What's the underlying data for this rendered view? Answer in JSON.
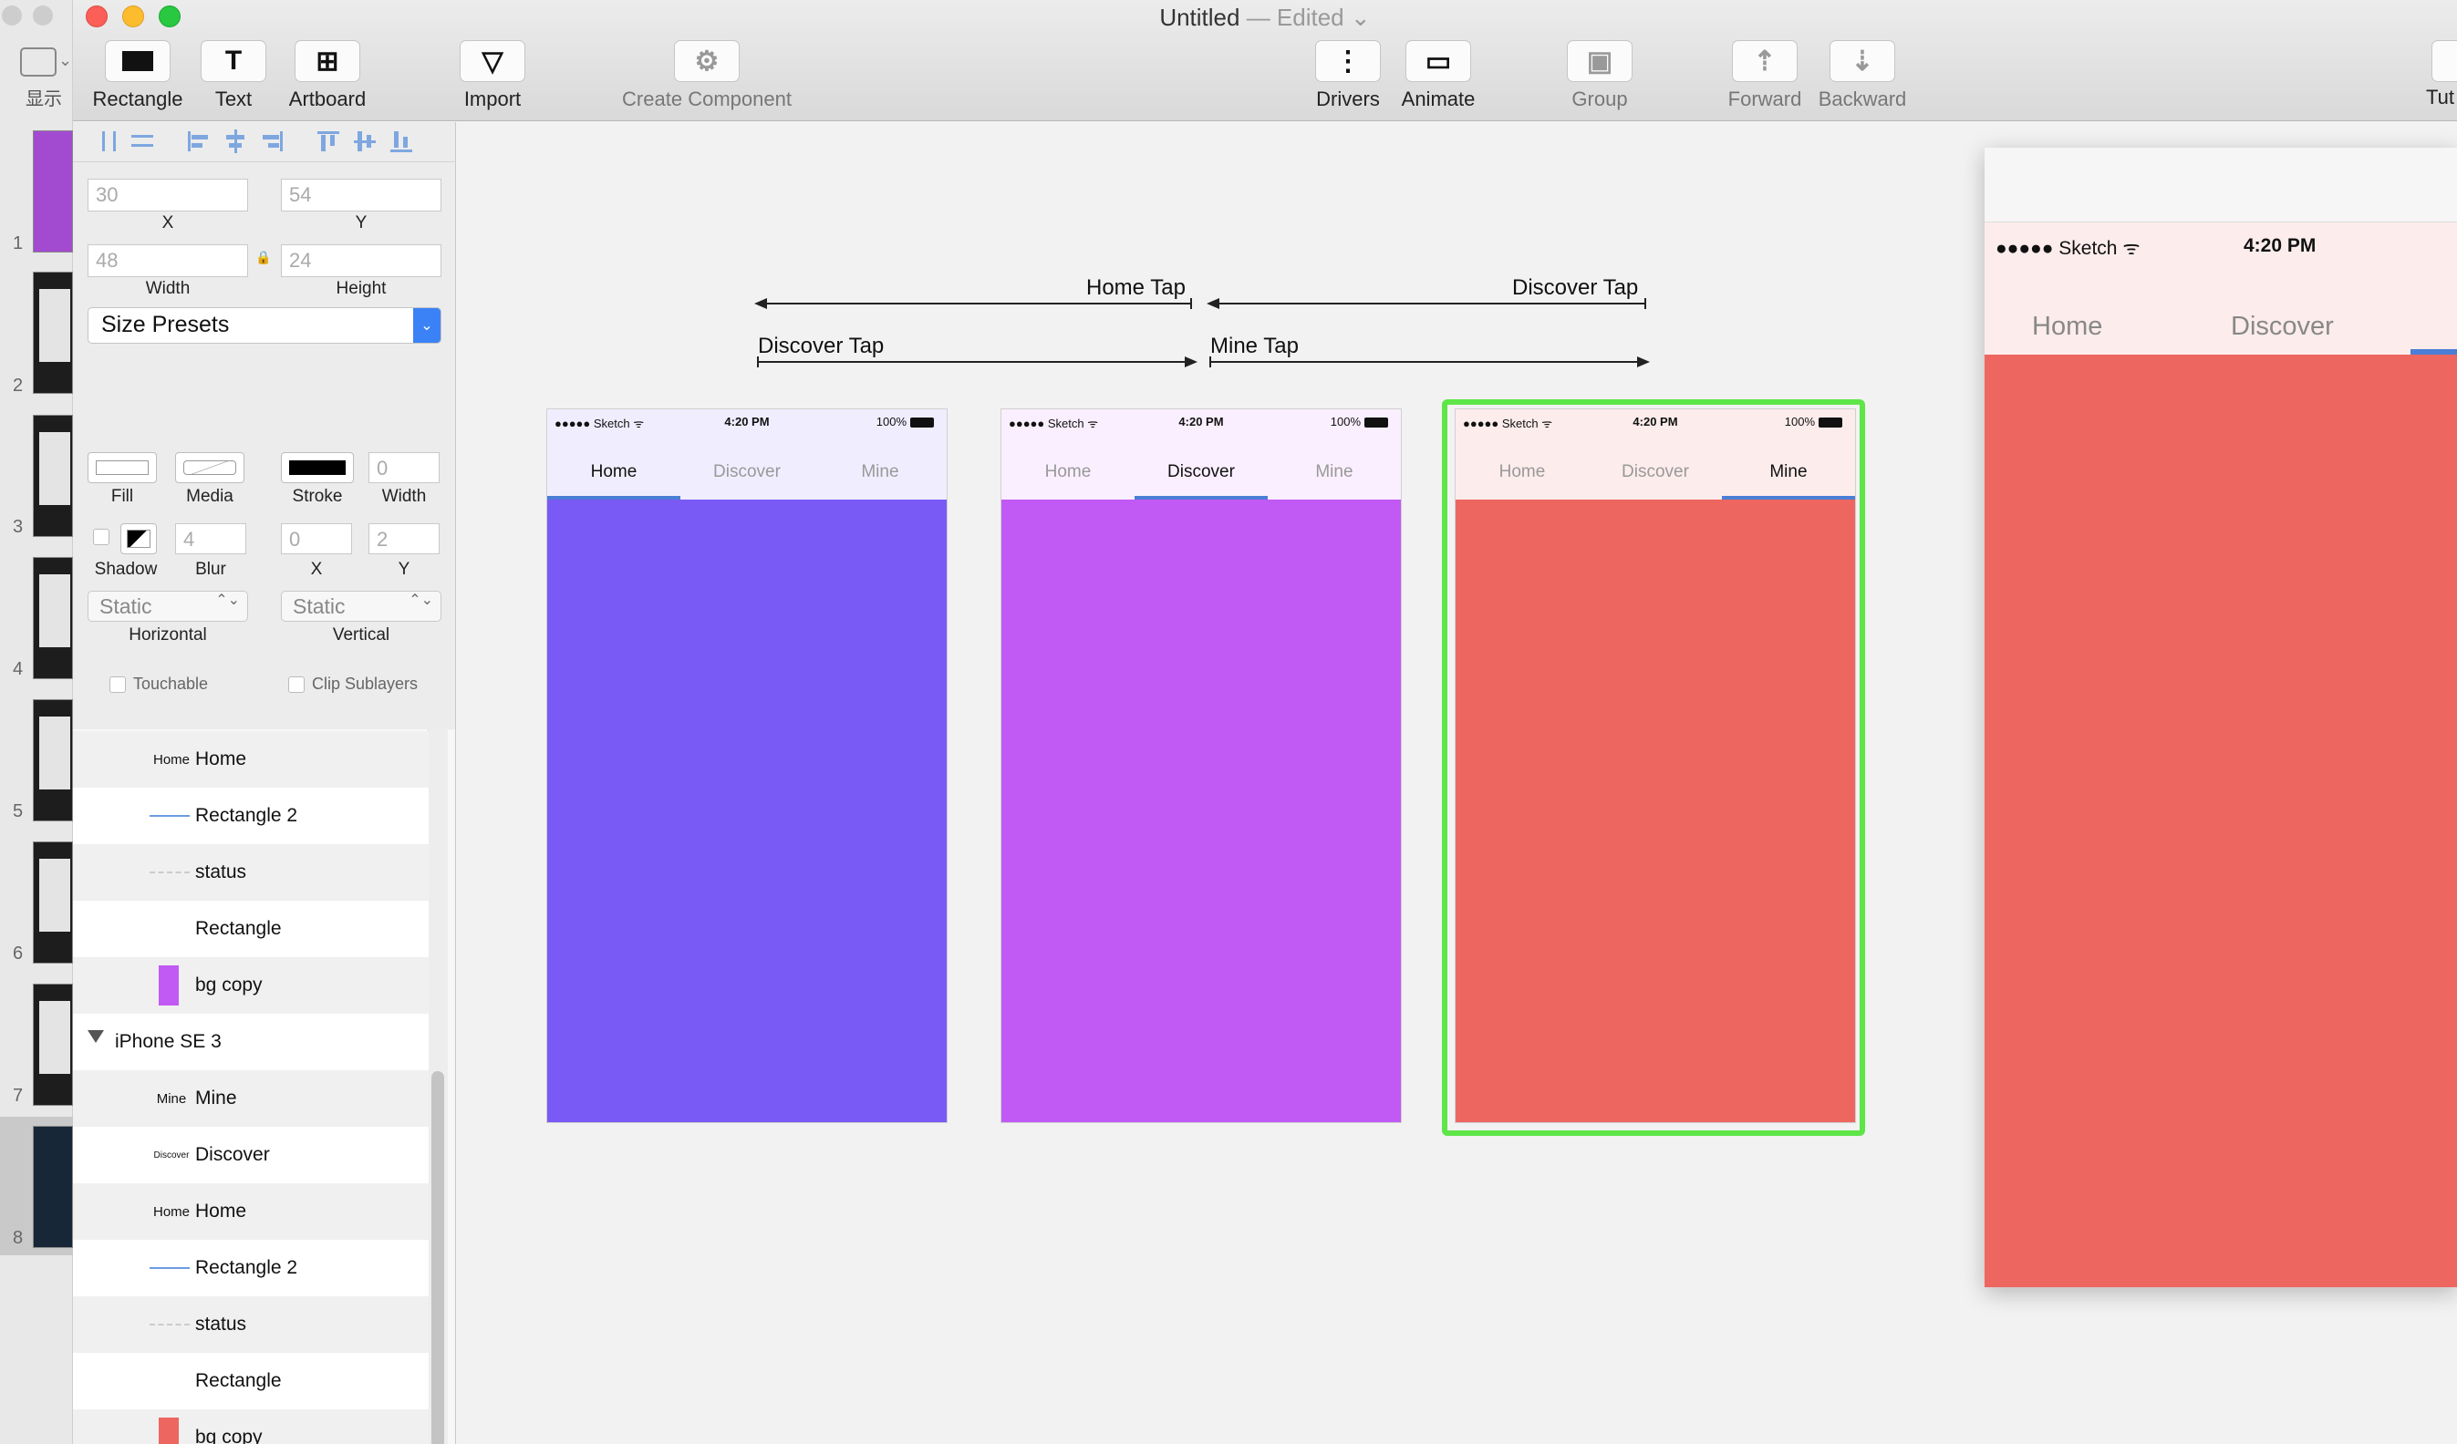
{
  "window": {
    "title": "Untitled",
    "title_separator": " — ",
    "title_status": "Edited",
    "title_chevron": "⌄"
  },
  "colors": {
    "home_bg": "#7a5af5",
    "discover_bg": "#c15af5",
    "mine_bg": "#ee6660",
    "selection_outline": "#5ee548",
    "tab_indicator": "#4a7fd6"
  },
  "background_window": {
    "view_label": "显示",
    "view_chevron": "⌄",
    "thumbnail_numbers": [
      "1",
      "2",
      "3",
      "4",
      "5",
      "6",
      "7",
      "8"
    ]
  },
  "toolbar": {
    "rectangle": {
      "label": "Rectangle",
      "icon": "rectangle-icon",
      "glyph": "▬"
    },
    "text": {
      "label": "Text",
      "icon": "text-icon",
      "glyph": "T"
    },
    "artboard": {
      "label": "Artboard",
      "icon": "artboard-icon",
      "glyph": "⊞"
    },
    "import": {
      "label": "Import",
      "icon": "import-icon",
      "glyph": "▽"
    },
    "create_component": {
      "label": "Create Component",
      "icon": "gear-icon",
      "glyph": "⚙"
    },
    "drivers": {
      "label": "Drivers",
      "icon": "drivers-icon",
      "glyph": "⋮"
    },
    "animate": {
      "label": "Animate",
      "icon": "animate-icon",
      "glyph": "▭"
    },
    "group": {
      "label": "Group",
      "icon": "group-icon",
      "glyph": "▣"
    },
    "forward": {
      "label": "Forward",
      "icon": "forward-icon",
      "glyph": "⇡"
    },
    "backward": {
      "label": "Backward",
      "icon": "backward-icon",
      "glyph": "⇣"
    },
    "tutorial": {
      "label": "Tut"
    }
  },
  "inspector": {
    "x": {
      "value": "30",
      "label": "X"
    },
    "y": {
      "value": "54",
      "label": "Y"
    },
    "width": {
      "value": "48",
      "label": "Width"
    },
    "height": {
      "value": "24",
      "label": "Height"
    },
    "lock_glyph": "🔒",
    "size_presets": "Size Presets",
    "dropdown_glyph": "⌄",
    "fill_label": "Fill",
    "media_label": "Media",
    "stroke_label": "Stroke",
    "stroke_width": {
      "value": "0",
      "label": "Width"
    },
    "shadow_label": "Shadow",
    "blur": {
      "value": "4",
      "label": "Blur"
    },
    "shadow_x": {
      "value": "0",
      "label": "X"
    },
    "shadow_y": {
      "value": "2",
      "label": "Y"
    },
    "horizontal": {
      "value": "Static",
      "label": "Horizontal"
    },
    "vertical": {
      "value": "Static",
      "label": "Vertical"
    },
    "stepper_glyph": "⌃⌄",
    "touchable_label": "Touchable",
    "clip_label": "Clip Sublayers"
  },
  "layers": [
    {
      "thumb": "Home",
      "name": "Home",
      "kind": "text"
    },
    {
      "thumb": "",
      "name": "Rectangle 2",
      "kind": "line"
    },
    {
      "thumb": "",
      "name": "status",
      "kind": "dash"
    },
    {
      "thumb": "",
      "name": "Rectangle",
      "kind": "blank"
    },
    {
      "thumb": "",
      "name": "bg copy",
      "kind": "swatch",
      "color": "#c15af5"
    },
    {
      "thumb": "",
      "name": "iPhone SE 3",
      "kind": "group"
    },
    {
      "thumb": "Mine",
      "name": "Mine",
      "kind": "text"
    },
    {
      "thumb": "Discover",
      "name": "Discover",
      "kind": "text"
    },
    {
      "thumb": "Home",
      "name": "Home",
      "kind": "text"
    },
    {
      "thumb": "",
      "name": "Rectangle 2",
      "kind": "line"
    },
    {
      "thumb": "",
      "name": "status",
      "kind": "dash"
    },
    {
      "thumb": "",
      "name": "Rectangle",
      "kind": "blank"
    },
    {
      "thumb": "",
      "name": "bg copy",
      "kind": "swatch",
      "color": "#ee6660"
    }
  ],
  "transitions": {
    "home_tap": "Home Tap",
    "discover_tap_top": "Discover Tap",
    "discover_tap_bottom": "Discover Tap",
    "mine_tap": "Mine Tap"
  },
  "artboards": [
    {
      "carrier": "●●●●● Sketch",
      "wifi": "ᯤ",
      "time": "4:20 PM",
      "battery": "100%",
      "tabs": [
        "Home",
        "Discover",
        "Mine"
      ],
      "active": 0
    },
    {
      "carrier": "●●●●● Sketch",
      "wifi": "ᯤ",
      "time": "4:20 PM",
      "battery": "100%",
      "tabs": [
        "Home",
        "Discover",
        "Mine"
      ],
      "active": 1
    },
    {
      "carrier": "●●●●● Sketch",
      "wifi": "ᯤ",
      "time": "4:20 PM",
      "battery": "100%",
      "tabs": [
        "Home",
        "Discover",
        "Mine"
      ],
      "active": 2
    }
  ],
  "preview": {
    "carrier": "●●●●● Sketch",
    "wifi": "ᯤ",
    "time": "4:20 PM",
    "tabs": [
      "Home",
      "Discover"
    ]
  }
}
